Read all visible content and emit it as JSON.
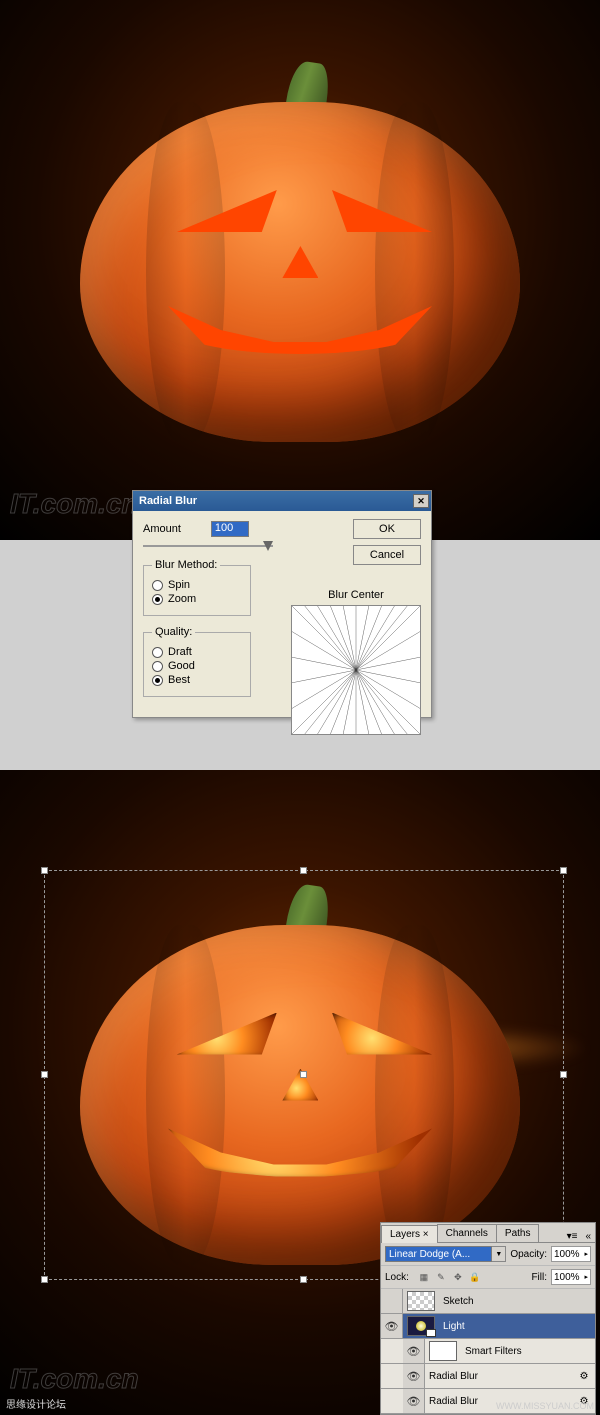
{
  "watermark": "IT.com.cn",
  "dialog": {
    "title": "Radial Blur",
    "amount_label": "Amount",
    "amount_value": "100",
    "ok": "OK",
    "cancel": "Cancel",
    "blur_method": {
      "legend": "Blur Method:",
      "options": [
        "Spin",
        "Zoom"
      ],
      "selected": "Zoom"
    },
    "quality": {
      "legend": "Quality:",
      "options": [
        "Draft",
        "Good",
        "Best"
      ],
      "selected": "Best"
    },
    "blur_center_label": "Blur Center"
  },
  "layers_panel": {
    "tabs": [
      "Layers",
      "Channels",
      "Paths"
    ],
    "active_tab": "Layers",
    "blend_mode": "Linear Dodge (A...",
    "opacity_label": "Opacity:",
    "opacity_value": "100%",
    "lock_label": "Lock:",
    "fill_label": "Fill:",
    "fill_value": "100%",
    "layers": [
      {
        "name": "Sketch",
        "visible": false,
        "selected": false
      },
      {
        "name": "Light",
        "visible": true,
        "selected": true
      }
    ],
    "smart_filters_label": "Smart Filters",
    "filters": [
      "Radial Blur",
      "Radial Blur"
    ]
  },
  "footer": {
    "left": "思缘设计论坛",
    "right": "WWW.MISSYUAN.COM"
  }
}
